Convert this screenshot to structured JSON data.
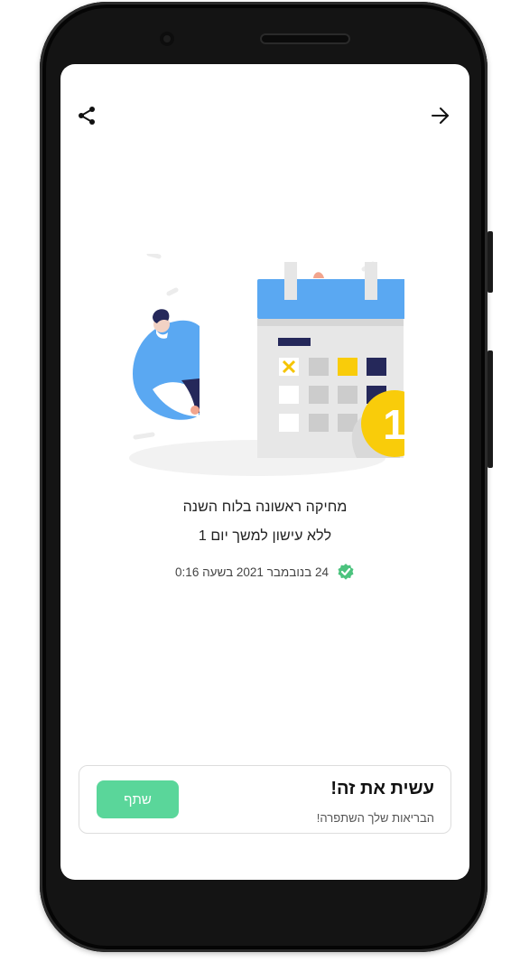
{
  "header": {
    "share_icon": "share-icon",
    "forward_icon": "arrow-right-icon"
  },
  "achievement": {
    "illustration_number": "1",
    "title_line1": "מחיקה ראשונה בלוח השנה",
    "title_line2": "ללא עישון למשך יום 1",
    "date_text": "24 בנובמבר 2021 בשעה 0:16",
    "verified_icon": "verified-badge-icon"
  },
  "share_card": {
    "title": "עשית את זה!",
    "subtitle": "הבריאות שלך השתפרה!",
    "button_label": "שתף"
  },
  "colors": {
    "accent_green": "#5ad69a",
    "calendar_blue": "#5aa8f2",
    "badge_yellow": "#f9cc0a",
    "navy": "#25285a"
  }
}
